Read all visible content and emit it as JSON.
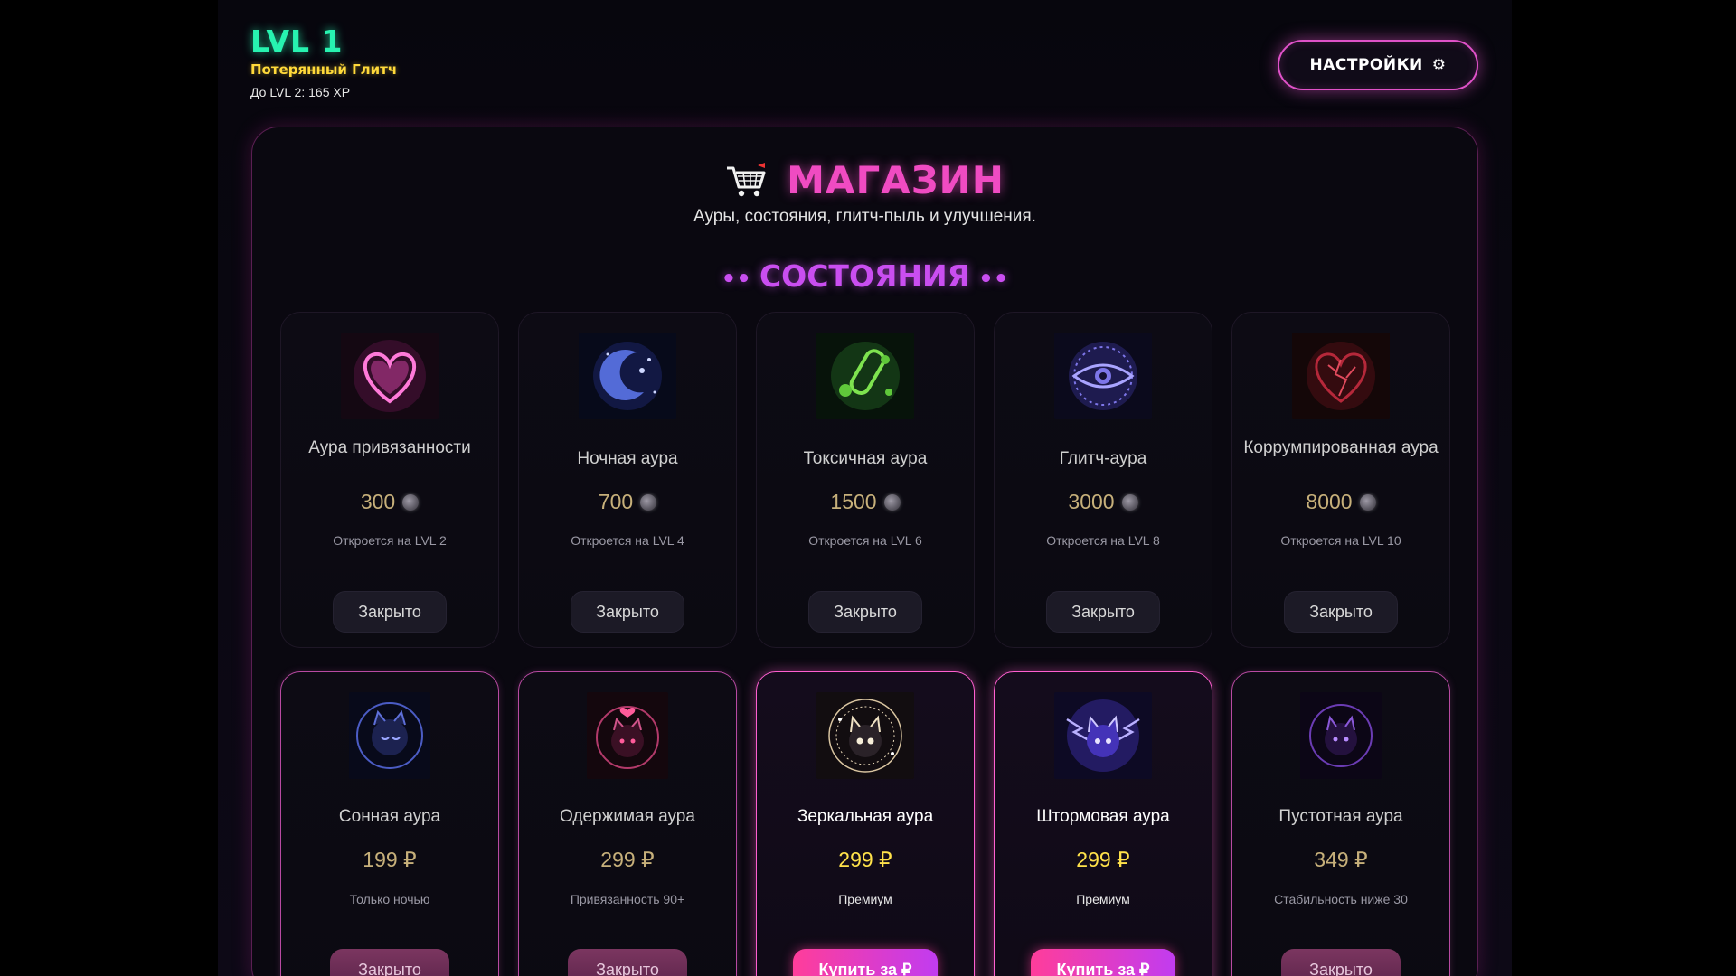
{
  "player": {
    "level": "LVL 1",
    "rank": "Потерянный Глитч",
    "next": "До LVL 2: 165 XP"
  },
  "settings": {
    "label": "НАСТРОЙКИ",
    "icon": "⚙"
  },
  "shop": {
    "title": "МАГАЗИН",
    "subtitle": "Ауры, состояния, глитч-пыль и улучшения.",
    "section": "СОСТОЯНИЯ",
    "section_prefix": "•• ",
    "section_suffix": " ••"
  },
  "cards": [
    {
      "name": "Аура привязанности",
      "price": "300",
      "note": "Откроется на LVL 2",
      "button": "Закрыто",
      "icon": "heart-aura-icon"
    },
    {
      "name": "Ночная аура",
      "price": "700",
      "note": "Откроется на LVL 4",
      "button": "Закрыто",
      "icon": "moon-aura-icon"
    },
    {
      "name": "Токсичная аура",
      "price": "1500",
      "note": "Откроется на LVL 6",
      "button": "Закрыто",
      "icon": "toxic-aura-icon"
    },
    {
      "name": "Глитч-аура",
      "price": "3000",
      "note": "Откроется на LVL 8",
      "button": "Закрыто",
      "icon": "eye-aura-icon"
    },
    {
      "name": "Коррумпированная аура",
      "price": "8000",
      "note": "Откроется на LVL 10",
      "button": "Закрыто",
      "icon": "corrupt-heart-aura-icon"
    },
    {
      "name": "Сонная аура",
      "price": "199 ₽",
      "note": "Только ночью",
      "button": "Закрыто",
      "icon": "sleepy-cat-aura-icon"
    },
    {
      "name": "Одержимая аура",
      "price": "299 ₽",
      "note": "Привязанность 90+",
      "button": "Закрыто",
      "icon": "obsessed-cat-aura-icon"
    },
    {
      "name": "Зеркальная аура",
      "price": "299 ₽",
      "note": "Премиум",
      "button": "Купить за ₽",
      "icon": "mirror-cat-aura-icon"
    },
    {
      "name": "Штормовая аура",
      "price": "299 ₽",
      "note": "Премиум",
      "button": "Купить за ₽",
      "icon": "storm-cat-aura-icon"
    },
    {
      "name": "Пустотная аура",
      "price": "349 ₽",
      "note": "Стабильность ниже 30",
      "button": "Закрыто",
      "icon": "void-cat-aura-icon"
    }
  ]
}
